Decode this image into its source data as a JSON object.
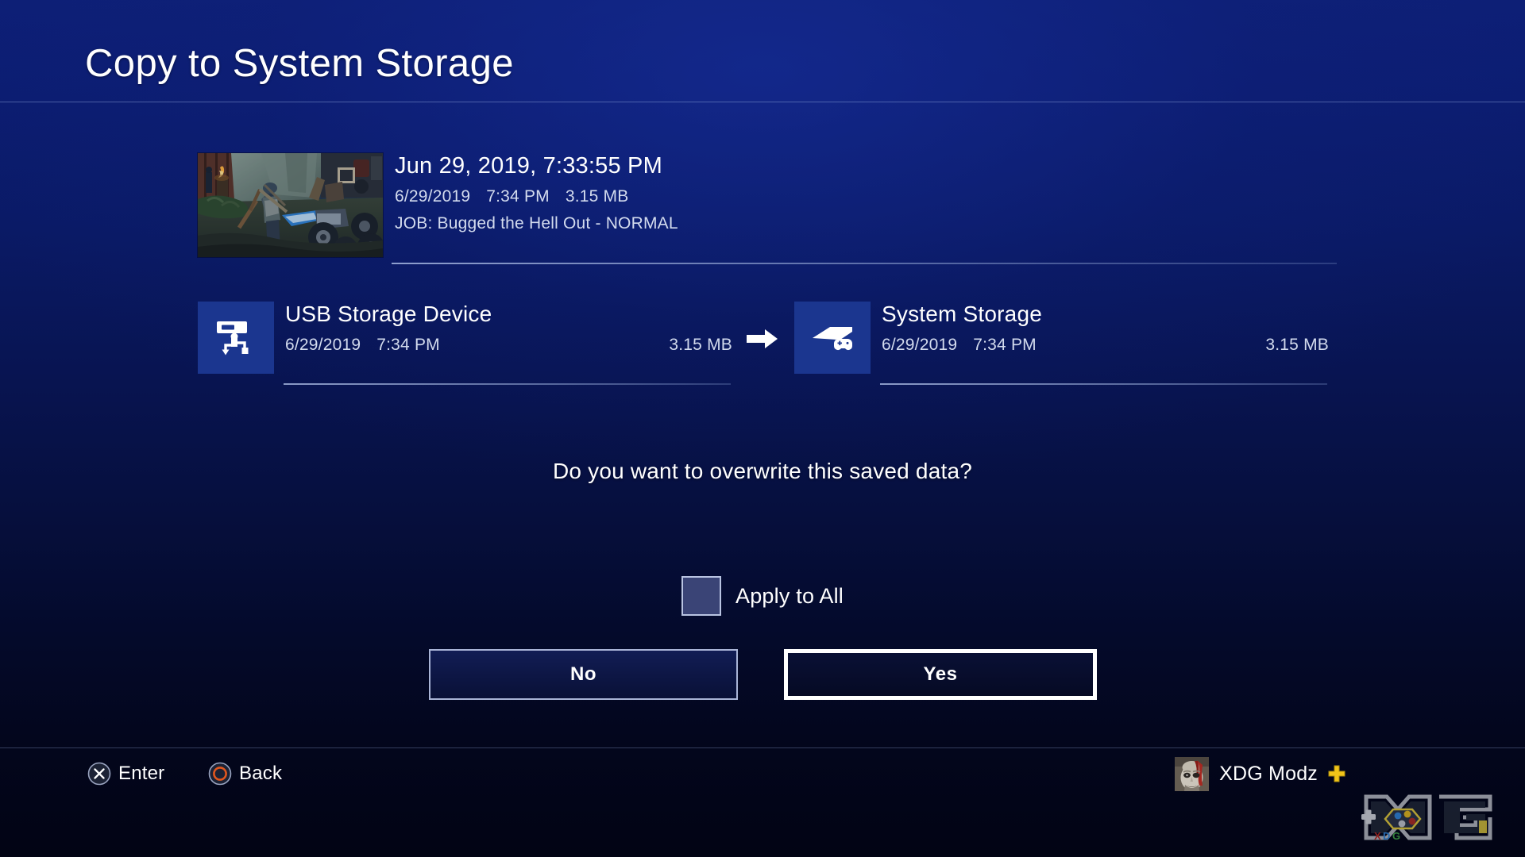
{
  "header": {
    "title": "Copy to System Storage"
  },
  "save_data": {
    "title": "Jun 29, 2019, 7:33:55 PM",
    "date": "6/29/2019",
    "time": "7:34 PM",
    "size": "3.15 MB",
    "subtitle": "JOB: Bugged the Hell Out - NORMAL",
    "thumbnail_name": "days-gone-screenshot-thumbnail"
  },
  "transfer": {
    "source": {
      "name": "USB Storage Device",
      "date": "6/29/2019",
      "time": "7:34 PM",
      "size": "3.15 MB",
      "icon": "usb-storage-icon"
    },
    "arrow_icon": "right-arrow-icon",
    "destination": {
      "name": "System Storage",
      "date": "6/29/2019",
      "time": "7:34 PM",
      "size": "3.15 MB",
      "icon": "ps4-console-icon"
    }
  },
  "prompt": {
    "message": "Do you want to overwrite this saved data?"
  },
  "apply_all": {
    "label": "Apply to All",
    "checked": false
  },
  "buttons": {
    "no_label": "No",
    "yes_label": "Yes",
    "focused": "Yes"
  },
  "footer": {
    "hints": [
      {
        "button_icon": "cross-button-icon",
        "label": "Enter"
      },
      {
        "button_icon": "circle-button-icon",
        "label": "Back"
      }
    ],
    "user": {
      "name": "XDG Modz",
      "avatar_icon": "kratos-avatar",
      "plus_icon": "ps-plus-icon"
    },
    "watermark": {
      "text": "XDG",
      "icon": "xdg-logo-watermark"
    }
  },
  "colors": {
    "background_top": "#0d1f76",
    "background_bottom": "#020414",
    "icon_tile": "#1b368f",
    "accent_white": "#ffffff",
    "meta_text": "#d3dbee",
    "circle_button_orange": "#e2561e",
    "ps_plus_yellow": "#f0c419"
  }
}
